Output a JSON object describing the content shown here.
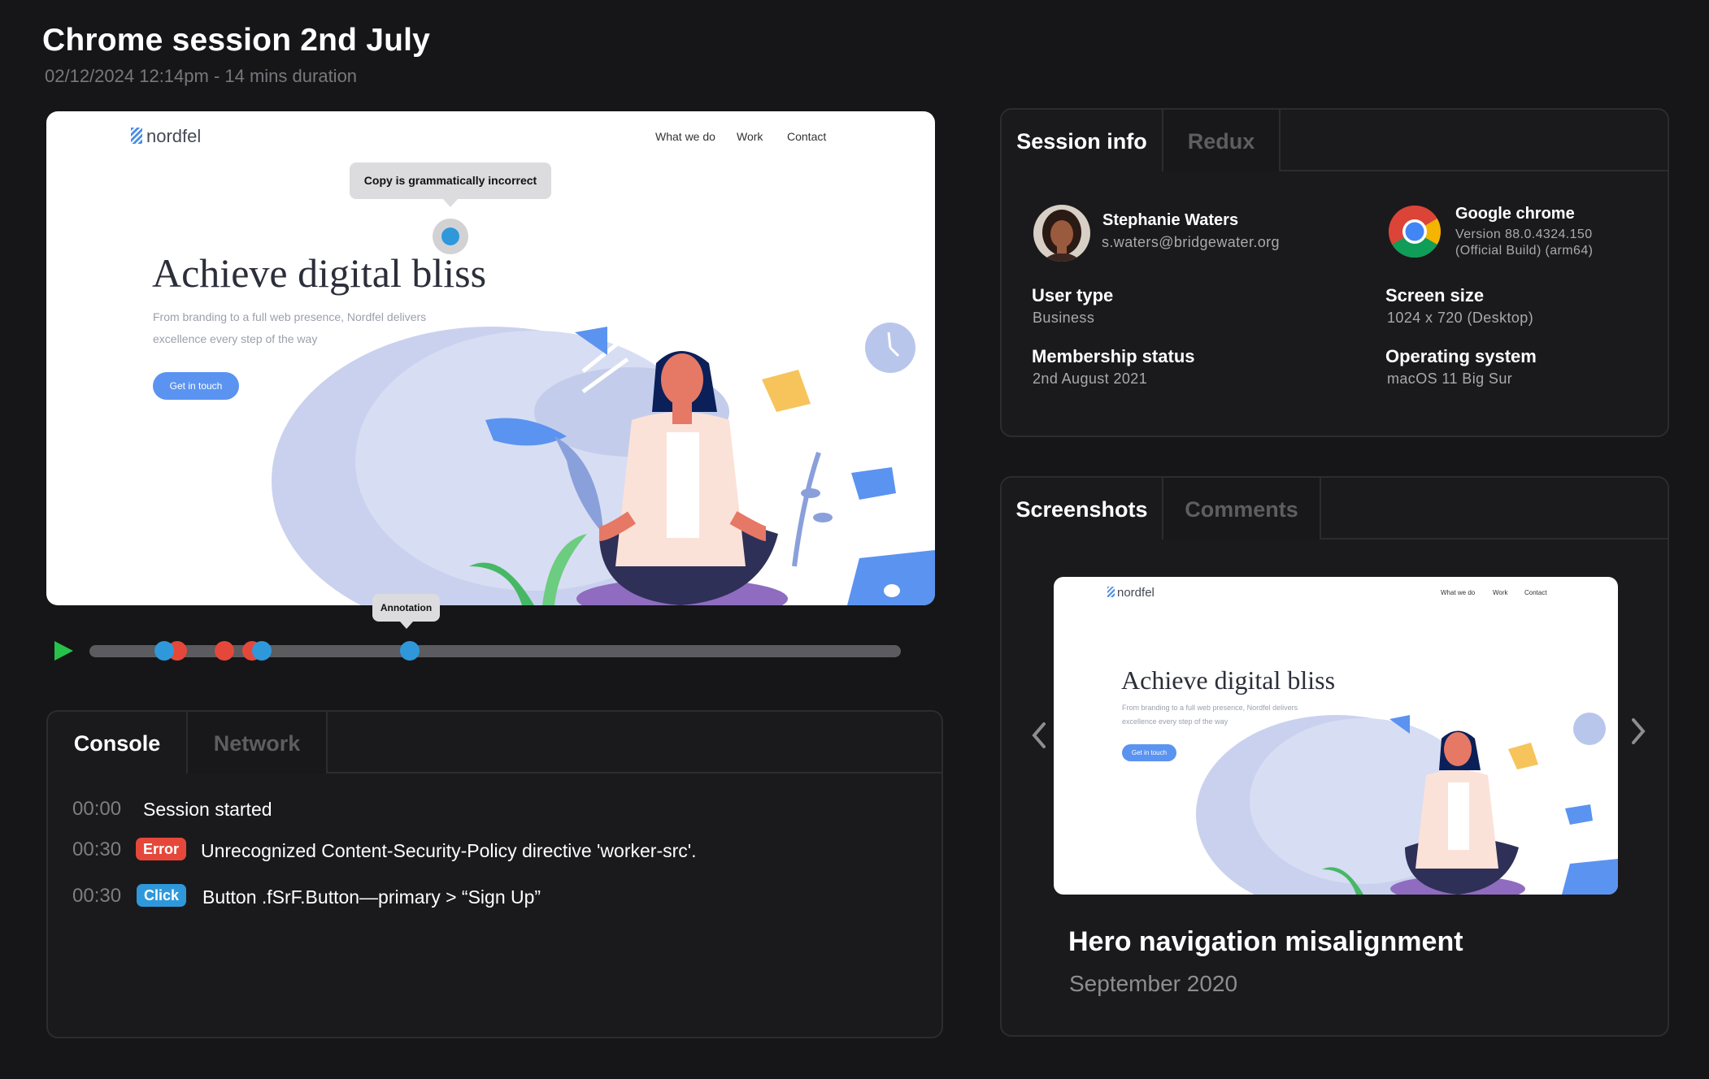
{
  "header": {
    "title": "Chrome session 2nd July",
    "subtitle": "02/12/2024 12:14pm - 14 mins duration"
  },
  "player": {
    "site": {
      "logo": "nordfel",
      "nav": [
        "What we do",
        "Work",
        "Contact"
      ],
      "headline": "Achieve digital bliss",
      "body_line1": "From branding to a full web presence, Nordfel delivers",
      "body_line2": "excellence every step of the way",
      "cta": "Get in touch"
    },
    "annotation_tooltip": "Copy is grammatically incorrect",
    "timeline_annotation": "Annotation",
    "timeline_markers": [
      {
        "kind": "error",
        "position": 0.09
      },
      {
        "kind": "click",
        "position": 0.092
      },
      {
        "kind": "error",
        "position": 0.11
      },
      {
        "kind": "error",
        "position": 0.166
      },
      {
        "kind": "error",
        "position": 0.197
      },
      {
        "kind": "click",
        "position": 0.211
      },
      {
        "kind": "click",
        "position": 0.395
      }
    ]
  },
  "console": {
    "tabs": [
      {
        "label": "Console",
        "active": true
      },
      {
        "label": "Network",
        "active": false
      }
    ],
    "logs": [
      {
        "time": "00:00",
        "badge": "",
        "text": "Session started"
      },
      {
        "time": "00:30",
        "badge": "Error",
        "text": "Unrecognized Content-Security-Policy directive 'worker-src'."
      },
      {
        "time": "00:30",
        "badge": "Click",
        "text": "Button .fSrF.Button—primary > “Sign Up”"
      }
    ]
  },
  "session_info": {
    "tabs": [
      {
        "label": "Session info",
        "active": true
      },
      {
        "label": "Redux",
        "active": false
      }
    ],
    "user": {
      "name": "Stephanie Waters",
      "email": "s.waters@bridgewater.org"
    },
    "browser": {
      "name": "Google chrome",
      "version": "Version 88.0.4324.150",
      "build": "(Official Build) (arm64)"
    },
    "fields": [
      {
        "label": "User type",
        "value": "Business"
      },
      {
        "label": "Screen size",
        "value": "1024 x 720 (Desktop)"
      },
      {
        "label": "Membership status",
        "value": "2nd August 2021"
      },
      {
        "label": "Operating system",
        "value": "macOS 11 Big Sur"
      }
    ]
  },
  "screenshots": {
    "tabs": [
      {
        "label": "Screenshots",
        "active": true
      },
      {
        "label": "Comments",
        "active": false
      }
    ],
    "current": {
      "title": "Hero navigation misalignment",
      "date": "September 2020"
    }
  },
  "colors": {
    "background": "#161618",
    "error": "#e5483a",
    "click": "#2f98db",
    "play": "#26c24a",
    "cta": "#5b93f0"
  },
  "icons": {
    "play": "play-icon",
    "prev": "chevron-left-icon",
    "next": "chevron-right-icon",
    "browser": "chrome-logo-icon",
    "logo": "nordfel-logo-icon"
  }
}
